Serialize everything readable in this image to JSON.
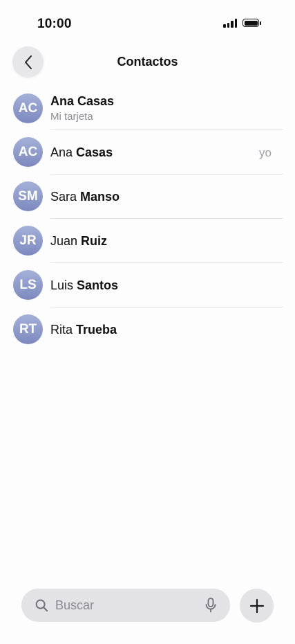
{
  "status_bar": {
    "time": "10:00"
  },
  "header": {
    "title": "Contactos"
  },
  "contacts": [
    {
      "initials": "AC",
      "first": "Ana Casas",
      "last": "",
      "subtitle": "Mi tarjeta",
      "badge": ""
    },
    {
      "initials": "AC",
      "first": "Ana ",
      "last": "Casas",
      "subtitle": "",
      "badge": "yo"
    },
    {
      "initials": "SM",
      "first": "Sara ",
      "last": "Manso",
      "subtitle": "",
      "badge": ""
    },
    {
      "initials": "JR",
      "first": "Juan ",
      "last": "Ruiz",
      "subtitle": "",
      "badge": ""
    },
    {
      "initials": "LS",
      "first": "Luis ",
      "last": "Santos",
      "subtitle": "",
      "badge": ""
    },
    {
      "initials": "RT",
      "first": "Rita ",
      "last": "Trueba",
      "subtitle": "",
      "badge": ""
    }
  ],
  "search": {
    "placeholder": "Buscar"
  },
  "icons": {
    "back": "chevron-left-icon",
    "search": "search-icon",
    "mic": "microphone-icon",
    "add": "plus-icon"
  },
  "colors": {
    "avatar_top": "#a3b1d9",
    "avatar_bottom": "#7d89bf",
    "control_bg": "#e3e3e5"
  }
}
